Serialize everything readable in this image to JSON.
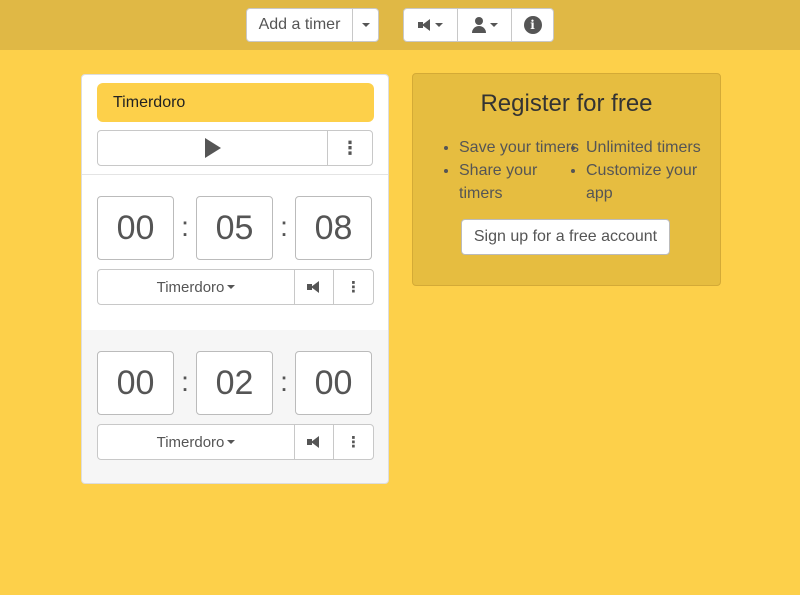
{
  "toolbar": {
    "add_timer_label": "Add a timer",
    "sound_icon": "speaker-icon",
    "user_icon": "user-icon",
    "info_icon": "info-icon",
    "info_glyph": "i"
  },
  "timer_card": {
    "title": "Timerdoro",
    "play_icon": "play-icon",
    "menu_glyph": "⋮",
    "timers": [
      {
        "hours": "00",
        "minutes": "05",
        "seconds": "08",
        "preset_label": "Timerdoro",
        "colon": ":"
      },
      {
        "hours": "00",
        "minutes": "02",
        "seconds": "00",
        "preset_label": "Timerdoro",
        "colon": ":"
      }
    ]
  },
  "register": {
    "title": "Register for free",
    "benefits_left": [
      "Save your timers",
      "Share your timers"
    ],
    "benefits_right": [
      "Unlimited timers",
      "Customize your app"
    ],
    "signup_label": "Sign up for a free account"
  },
  "colors": {
    "background": "#fdd04a",
    "topbar": "#e0b845",
    "register_panel": "#e6bd40",
    "title_highlight": "#fdd04a"
  }
}
